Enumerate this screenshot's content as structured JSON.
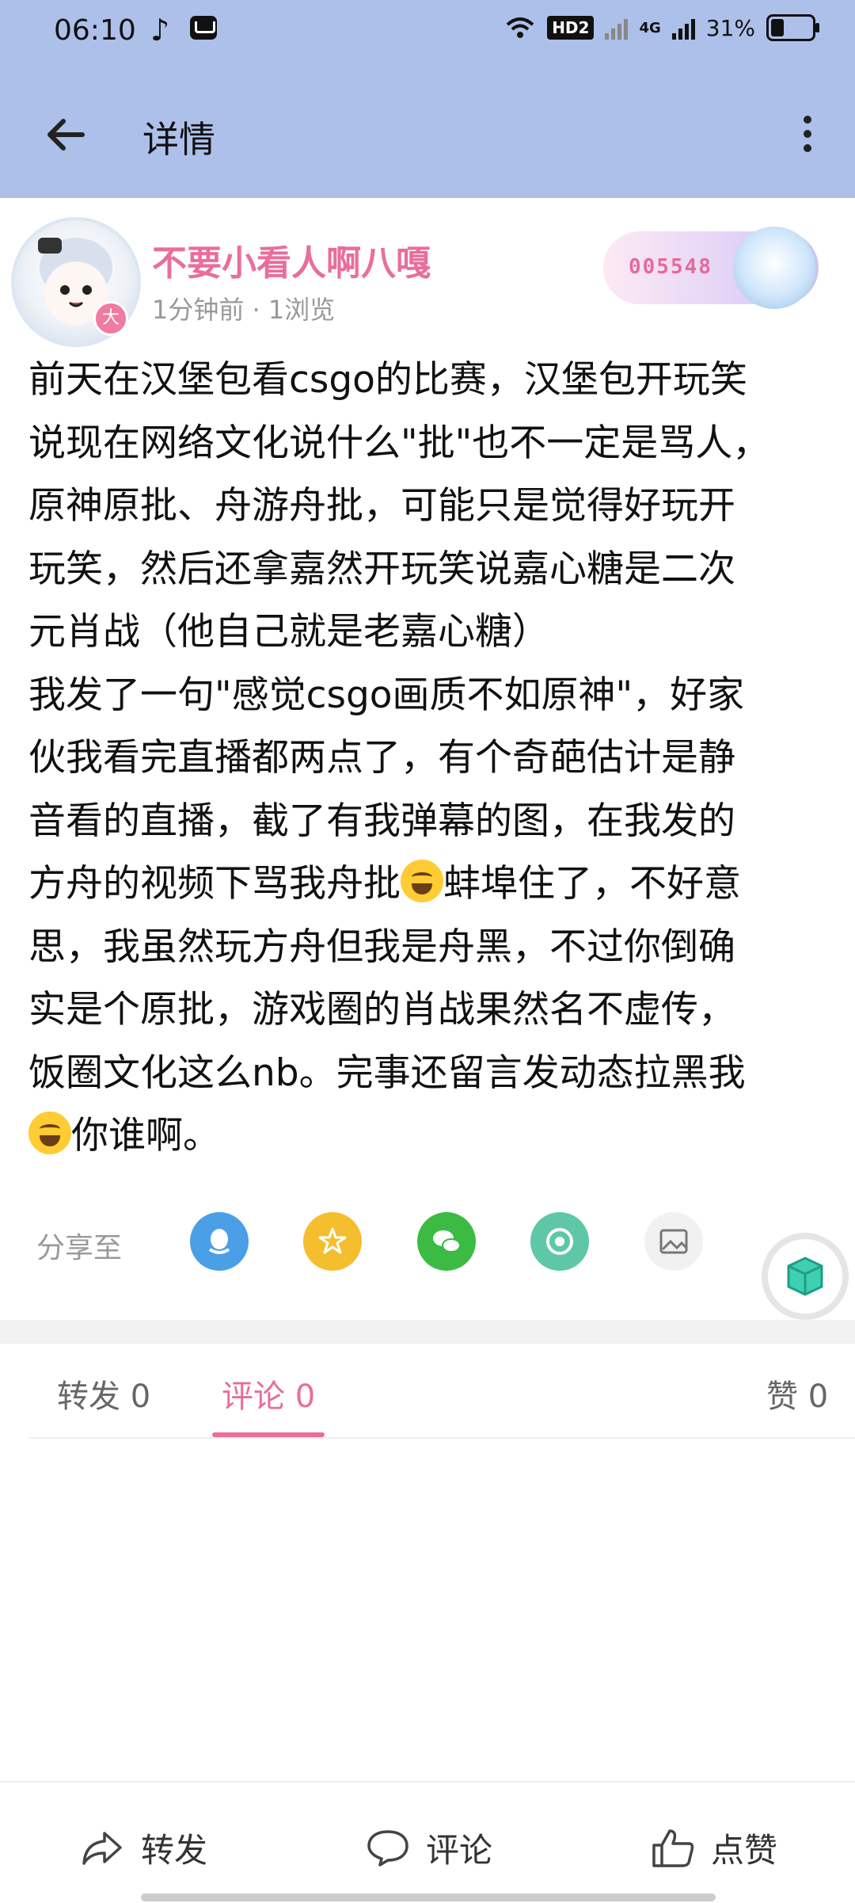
{
  "status_bar": {
    "time": "06:10",
    "hd_label": "HD2",
    "network_label": "4G",
    "battery_percent": "31%"
  },
  "header": {
    "title": "详情"
  },
  "post": {
    "username": "不要小看人啊八嘎",
    "meta": "1分钟前 · 1浏览",
    "badge_char": "大",
    "decoration_number": "005548",
    "content_part1": "前天在汉堡包看csgo的比赛，汉堡包开玩笑\n说现在网络文化说什么\"批\"也不一定是骂人，\n原神原批、舟游舟批，可能只是觉得好玩开\n玩笑，然后还拿嘉然开玩笑说嘉心糖是二次\n元肖战（他自己就是老嘉心糖）\n我发了一句\"感觉csgo画质不如原神\"，好家\n伙我看完直播都两点了，有个奇葩估计是静\n音看的直播，截了有我弹幕的图，在我发的\n方舟的视频下骂我舟批",
    "content_part2": "蚌埠住了，不好意\n思，我虽然玩方舟但我是舟黑，不过你倒确\n实是个原批，游戏圈的肖战果然名不虚传，\n饭圈文化这么nb。完事还留言发动态拉黑我\n",
    "content_part3": "你谁啊。"
  },
  "share": {
    "label": "分享至",
    "targets": [
      {
        "icon": "qq-icon",
        "color": "#4a9fe6"
      },
      {
        "icon": "qzone-icon",
        "color": "#f5be2f"
      },
      {
        "icon": "wechat-icon",
        "color": "#3cbb44"
      },
      {
        "icon": "moments-icon",
        "color": "#5ec7a5"
      },
      {
        "icon": "image-share-icon",
        "color": "#f1f1f1"
      }
    ]
  },
  "tabs": [
    {
      "label": "转发 0"
    },
    {
      "label": "评论 0",
      "active": true
    },
    {
      "label": "赞 0"
    }
  ],
  "bottom_bar": {
    "repost": "转发",
    "comment": "评论",
    "like": "点赞"
  },
  "colors": {
    "header": "#adc0ea",
    "accent": "#ea6d9b",
    "meta_text": "#999999"
  }
}
